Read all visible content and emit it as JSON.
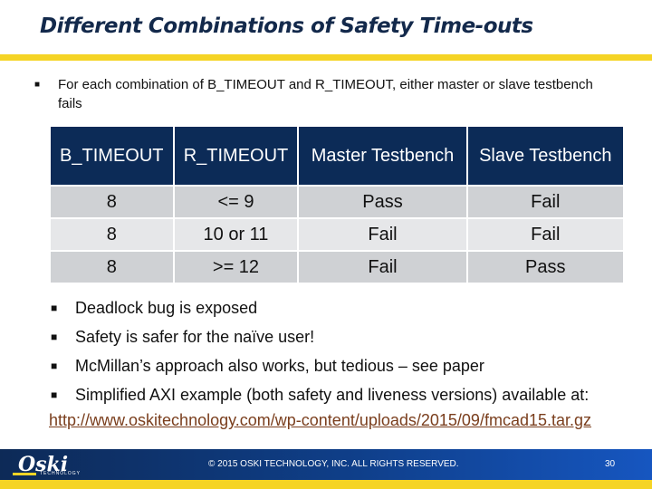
{
  "slide": {
    "title": "Different Combinations of Safety Time-outs",
    "intro": "For each combination of B_TIMEOUT and R_TIMEOUT, either master or slave testbench fails",
    "bullet_glyph": "■"
  },
  "table": {
    "headers": [
      "B_TIMEOUT",
      "R_TIMEOUT",
      "Master Testbench",
      "Slave Testbench"
    ],
    "rows": [
      [
        "8",
        "<= 9",
        "Pass",
        "Fail"
      ],
      [
        "8",
        "10 or 11",
        "Fail",
        "Fail"
      ],
      [
        "8",
        ">= 12",
        "Fail",
        "Pass"
      ]
    ]
  },
  "bullets": [
    "Deadlock bug is exposed",
    "Safety is safer for the naïve user!",
    "McMillan’s approach also works, but tedious – see paper",
    "Simplified AXI example (both safety and liveness versions) available at:"
  ],
  "link": "http://www.oskitechnology.com/wp-content/uploads/2015/09/fmcad15.tar.gz",
  "footer": {
    "logo": "Oski",
    "logo_sub": "TECHNOLOGY",
    "copyright": "© 2015 OSKI TECHNOLOGY, INC.  ALL RIGHTS RESERVED.",
    "page_number": "30"
  },
  "colors": {
    "title": "#13294b",
    "accent_gold": "#f5d425",
    "table_header": "#0c2b57",
    "link": "#7a3e1d"
  }
}
